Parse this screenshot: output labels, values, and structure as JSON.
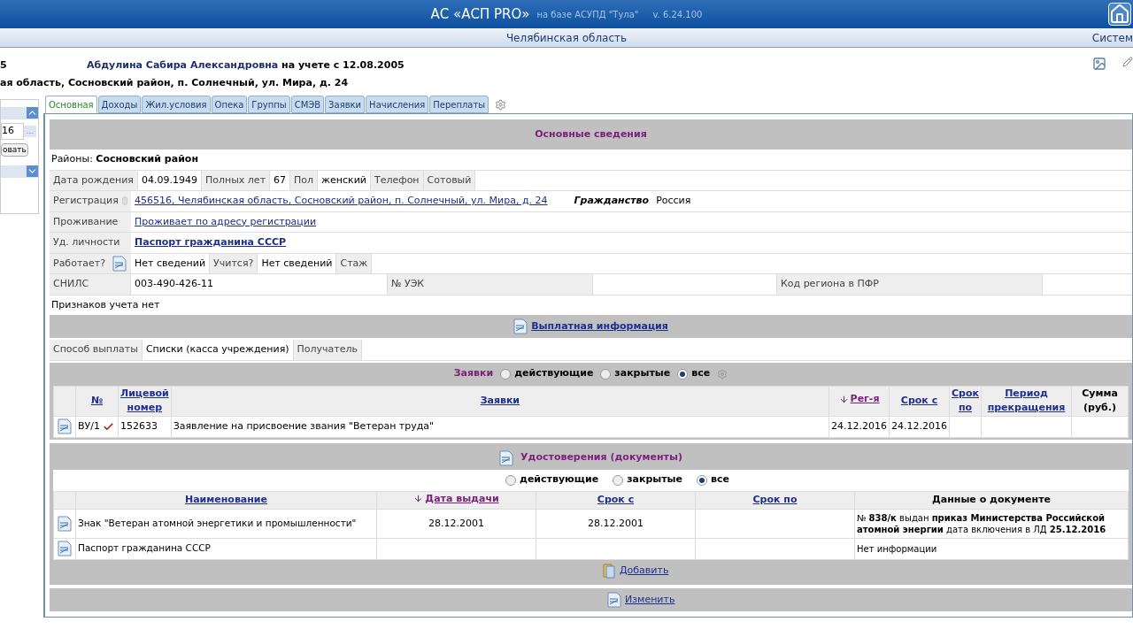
{
  "header": {
    "title": "АС «АСП PRO»",
    "subtitle": "на базе АСУПД \"Тула\"",
    "version": "v. 6.24.100"
  },
  "subheader": {
    "region": "Челябинская область",
    "menu": "Систем"
  },
  "person": {
    "record_no": "5",
    "name": "Абдулина Сабира Александровна",
    "since": "на учете с 12.08.2005",
    "address": "ая область, Сосновский район, п. Солнечный, ул. Мира, д. 24"
  },
  "left_panel": {
    "date_value": "16",
    "picker": "...",
    "button": "овать"
  },
  "tabs": [
    {
      "label": "Основная",
      "selected": true
    },
    {
      "label": "Доходы",
      "selected": false
    },
    {
      "label": "Жил.условия",
      "selected": false
    },
    {
      "label": "Опека",
      "selected": false
    },
    {
      "label": "Группы",
      "selected": false
    },
    {
      "label": "СМЭВ",
      "selected": false
    },
    {
      "label": "Заявки",
      "selected": false
    },
    {
      "label": "Начисления",
      "selected": false
    },
    {
      "label": "Переплаты",
      "selected": false
    }
  ],
  "main_title": "Основные сведения",
  "district": {
    "label": "Районы:",
    "value": "Сосновский район"
  },
  "birth_row": [
    {
      "text": "Дата рождения",
      "kind": "label"
    },
    {
      "text": "04.09.1949",
      "kind": "value"
    },
    {
      "text": "Полных лет",
      "kind": "label"
    },
    {
      "text": "67",
      "kind": "value"
    },
    {
      "text": "Пол",
      "kind": "label"
    },
    {
      "text": "женский",
      "kind": "value"
    },
    {
      "text": "Телефон",
      "kind": "label"
    },
    {
      "text": "Сотовый",
      "kind": "label"
    }
  ],
  "registration": {
    "label": "Регистрация",
    "address": "456516, Челябинская область, Сосновский район, п. Солнечный, ул. Мира, д. 24",
    "citizenship_label": "Гражданство",
    "citizenship": "Россия"
  },
  "residence": {
    "label": "Проживание",
    "value": "Проживает по адресу регистрации"
  },
  "identity": {
    "label": "Уд. личности",
    "value": "Паспорт гражданина СССР"
  },
  "work_row": [
    {
      "text": "Работает?",
      "kind": "label"
    },
    {
      "text": "Нет сведений",
      "kind": "value"
    },
    {
      "text": "Учится?",
      "kind": "label"
    },
    {
      "text": "Нет сведений",
      "kind": "value"
    },
    {
      "text": "Стаж",
      "kind": "label"
    }
  ],
  "snils_row": [
    {
      "text": "СНИЛС",
      "kind": "label"
    },
    {
      "text": "003-490-426-11",
      "kind": "value"
    },
    {
      "text": "№ УЭК",
      "kind": "label"
    },
    {
      "kind": "blank"
    },
    {
      "text": "Код региона в ПФР",
      "kind": "label"
    }
  ],
  "signs": "Признаков учета нет",
  "payment": {
    "title": "Выплатная информация",
    "cells": [
      {
        "text": "Способ выплаты",
        "kind": "label"
      },
      {
        "text": "Списки (касса учреждения)",
        "kind": "value"
      },
      {
        "text": "Получатель",
        "kind": "label"
      }
    ]
  },
  "applications": {
    "title": "Заявки",
    "filters": [
      {
        "label": "действующие",
        "selected": false
      },
      {
        "label": "закрытые",
        "selected": false
      },
      {
        "label": "все",
        "selected": true
      }
    ],
    "columns": [
      "№",
      "Лицевой номер",
      "Заявки",
      "Рег-я",
      "Срок с",
      "Срок по",
      "Период прекращения",
      "Сумма (руб.)"
    ],
    "rows": [
      {
        "number": "ВУ/1",
        "checked": true,
        "account": "152633",
        "name": "Заявление на присвоение звания \"Ветеран труда\"",
        "registered": "24.12.2016",
        "from": "24.12.2016"
      }
    ]
  },
  "documents": {
    "title": "Удостоверения (документы)",
    "filters": [
      {
        "label": "действующие",
        "selected": false
      },
      {
        "label": "закрытые",
        "selected": false
      },
      {
        "label": "все",
        "selected": true
      }
    ],
    "columns": [
      "Наименование",
      "Дата выдачи",
      "Срок с",
      "Срок по",
      "Данные о документе"
    ],
    "rows": [
      {
        "name": "Знак \"Ветеран атомной энергетики и промышленности\"",
        "issued": "28.12.2001",
        "from": "28.12.2001",
        "info": "№ **838/к** выдан **приказ Министерства Российской атомной энергии** дата включения в ЛД **25.12.2016**"
      },
      {
        "name": "Паспорт гражданина СССР",
        "info": "Нет информации"
      }
    ],
    "add": "Добавить"
  },
  "edit": "Изменить"
}
